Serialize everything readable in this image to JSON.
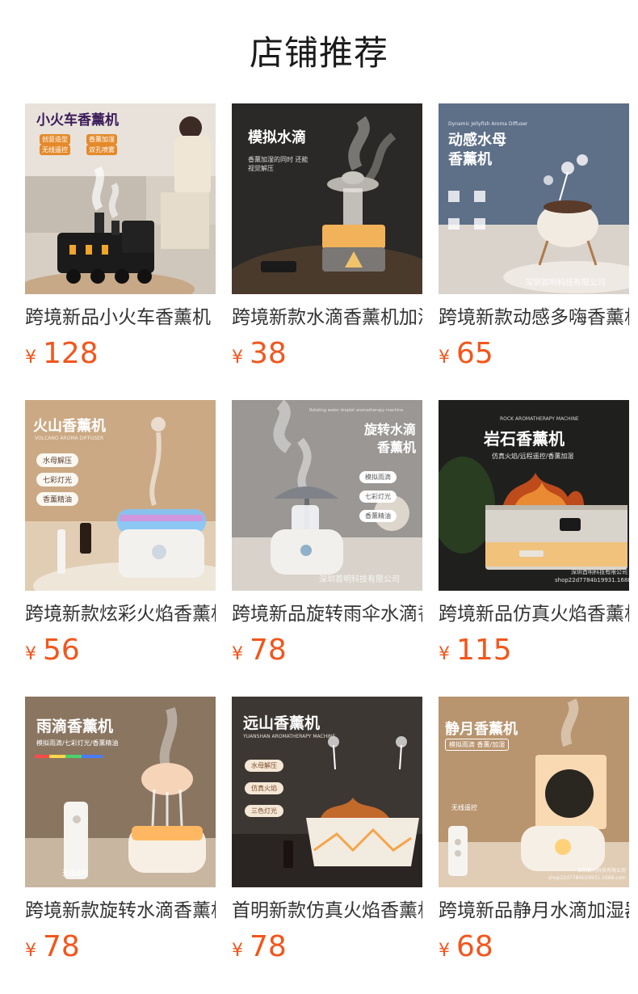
{
  "section": {
    "title": "店铺推荐"
  },
  "currency_symbol": "¥",
  "products": [
    {
      "name": "跨境新品小火车香薰机",
      "price": "128",
      "image": {
        "title": "小火车香薰机",
        "chips": [
          "创意造型",
          "香薰加湿",
          "无线遥控",
          "双孔喷雾"
        ],
        "title_color": "#3a1a5a",
        "bg": "#d9d1c6"
      }
    },
    {
      "name": "跨境新款水滴香薰机加湿器",
      "price": "38",
      "image": {
        "title": "模拟水滴",
        "subtitle": "香薰加湿的同时 还能视觉解压",
        "title_color": "#ffffff",
        "bg": "#2b2a28"
      }
    },
    {
      "name": "跨境新款动感多嗨香薰机",
      "price": "65",
      "image": {
        "small": "Dynamic Jellyfish Aroma Diffuser",
        "title": "动感水母 香薰机",
        "watermark": "深圳首明科技有限公司",
        "title_color": "#ffffff",
        "bg": "#5a6b86"
      }
    },
    {
      "name": "跨境新款炫彩火焰香薰机",
      "price": "56",
      "image": {
        "title": "火山香薰机",
        "small": "VOLCANO AROMA DIFFUSER",
        "chips": [
          "水母解压",
          "七彩灯光",
          "香薰精油"
        ],
        "title_color": "#ffffff",
        "bg": "#c9a883"
      }
    },
    {
      "name": "跨境新品旋转雨伞水滴香薰机",
      "price": "78",
      "image": {
        "small": "Rotating water droplet aromatherapy machine",
        "title": "旋转水滴 香薰机",
        "chips": [
          "模拟雨滴",
          "七彩灯光",
          "香薰精油"
        ],
        "watermark": "深圳首明科技有限公司",
        "title_color": "#ffffff",
        "bg": "#9a9896"
      }
    },
    {
      "name": "跨境新品仿真火焰香薰机",
      "price": "115",
      "image": {
        "small": "ROCK AROMATHERAPY MACHINE",
        "title": "岩石香薰机",
        "subtitle": "仿真火焰/远程遥控/香薰加湿",
        "watermark": "深圳首明科技有限公司 shop22d7784b19931.1688.com",
        "title_color": "#ffffff",
        "bg": "#1e1e1d"
      }
    },
    {
      "name": "跨境新款旋转水滴香薰机",
      "price": "78",
      "image": {
        "title": "雨滴香薰机",
        "subtitle": "模拟雨滴/七彩灯光/香薰精油",
        "label": "无线遥控",
        "title_color": "#ffffff",
        "bg": "#8a7660"
      }
    },
    {
      "name": "首明新款仿真火焰香薰机",
      "price": "78",
      "image": {
        "title": "远山香薰机",
        "small": "YUANSHAN AROMATHERAPY MACHINE",
        "chips": [
          "水母解压",
          "仿真火焰",
          "三色灯光"
        ],
        "title_color": "#ffffff",
        "bg": "#3e3834"
      }
    },
    {
      "name": "跨境新品静月水滴加湿器",
      "price": "68",
      "image": {
        "title": "静月香薰机",
        "subtitle": "模拟雨滴 香薰/加湿",
        "label": "无线遥控",
        "watermark": "深圳首明科技有限公司 shop22d7784b19931.1688.com",
        "title_color": "#ffffff",
        "bg": "#b89470"
      }
    }
  ]
}
